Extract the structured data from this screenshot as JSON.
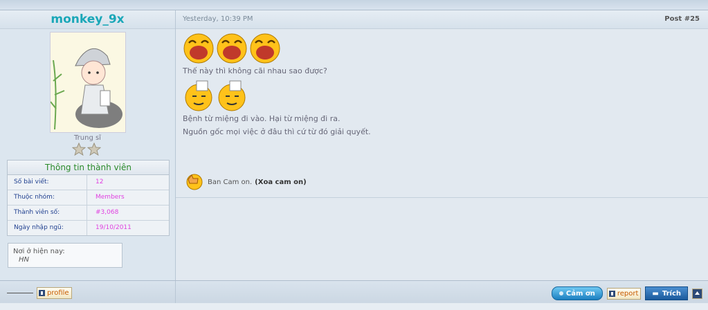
{
  "user": {
    "name": "monkey_9x",
    "rank": "Trung sĩ",
    "info_title": "Thông tin thành viên",
    "info": [
      {
        "label": "Số bài viết:",
        "value": "12"
      },
      {
        "label": "Thuộc nhóm:",
        "value": "Members"
      },
      {
        "label": "Thành viên số:",
        "value": "#3,068"
      },
      {
        "label": "Ngày nhập ngũ:",
        "value": "19/10/2011"
      }
    ],
    "location_label": "Nơi ở hiện nay:",
    "location_value": "HN"
  },
  "post": {
    "date": "Yesterday, 10:39 PM",
    "number": "Post #25",
    "lines": [
      "Thế này thì không cãi nhau sao được?",
      "Bệnh từ miệng đi vào. Hại từ miệng đi ra.",
      "Nguồn gốc mọi việc ở đâu thì cứ từ đó giải quyết."
    ],
    "thanks_text": "Ban Cam on.",
    "thanks_remove": "(Xoa cam on)"
  },
  "footer": {
    "profile_label": "profile",
    "camon_label": "Cảm ơn",
    "report_label": "report",
    "trich_label": "Trích"
  },
  "colors": {
    "username": "#1aa7b8",
    "info_value": "#e040e0",
    "info_title": "#2a8a2a"
  }
}
